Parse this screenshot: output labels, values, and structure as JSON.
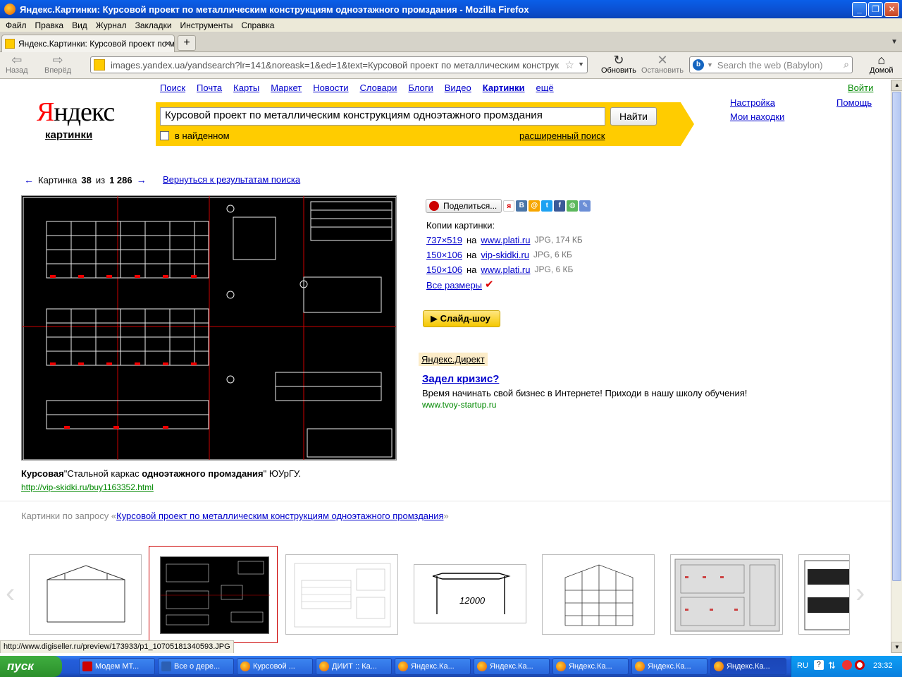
{
  "window": {
    "title": "Яндекс.Картинки: Курсовой проект по металлическим конструкциям одноэтажного промздания - Mozilla Firefox"
  },
  "menu": [
    "Файл",
    "Правка",
    "Вид",
    "Журнал",
    "Закладки",
    "Инструменты",
    "Справка"
  ],
  "tab": {
    "label": "Яндекс.Картинки: Курсовой проект по ме..."
  },
  "nav": {
    "back": "Назад",
    "forward": "Вперёд",
    "url": "images.yandex.ua/yandsearch?lr=141&noreask=1&ed=1&text=Курсовой проект по металлическим конструк",
    "reload": "Обновить",
    "stop": "Остановить",
    "search_placeholder": "Search the web (Babylon)",
    "home": "Домой"
  },
  "yandex": {
    "logo": "Яндекс",
    "logo_sub": "картинки",
    "services": [
      "Поиск",
      "Почта",
      "Карты",
      "Маркет",
      "Новости",
      "Словари",
      "Блоги",
      "Видео",
      "Картинки",
      "ещё"
    ],
    "query": "Курсовой проект по металлическим конструкциям одноэтажного промздания",
    "search_button": "Найти",
    "in_found": "в найденном",
    "advanced": "расширенный поиск",
    "login": "Войти",
    "settings": "Настройка",
    "help": "Помощь",
    "my_finds": "Мои находки"
  },
  "pager": {
    "prefix": "Картинка",
    "current": "38",
    "of": "из",
    "total": "1 286",
    "back_to_results": "Вернуться к результатам поиска"
  },
  "image": {
    "caption_bold1": "Курсовая",
    "caption_mid": "\"Стальной каркас ",
    "caption_bold2": "одноэтажного промздания",
    "caption_end": "\" ЮУрГУ.",
    "url": "http://vip-skidki.ru/buy1163352.html"
  },
  "share": {
    "label": "Поделиться..."
  },
  "copies": {
    "title": "Копии картинки:",
    "on": "на",
    "rows": [
      {
        "dims": "737×519",
        "site": "www.plati.ru",
        "meta": "JPG, 174 КБ"
      },
      {
        "dims": "150×106",
        "site": "vip-skidki.ru",
        "meta": "JPG, 6 КБ"
      },
      {
        "dims": "150×106",
        "site": "www.plati.ru",
        "meta": "JPG, 6 КБ"
      }
    ],
    "all_sizes": "Все размеры"
  },
  "slideshow": "Слайд-шоу",
  "ad": {
    "direct": "Яндекс.Директ",
    "title": "Задел кризис?",
    "text": "Время начинать свой бизнес в Интернете! Приходи в нашу школу обучения!",
    "url": "www.tvoy-startup.ru"
  },
  "related": {
    "prefix": "Картинки по запросу «",
    "query": "Курсовой проект по металлическим конструкциям одноэтажного промздания",
    "suffix": "»"
  },
  "thumb_text": {
    "span": "12000"
  },
  "status_bar": "http://www.digiseller.ru/preview/173933/p1_10705181340593.JPG",
  "taskbar": {
    "start": "пуск",
    "tasks": [
      "Модем МТ...",
      "Все о дере...",
      "Курсовой ...",
      "ДИИТ :: Ка...",
      "Яндекс.Ка...",
      "Яндекс.Ка...",
      "Яндекс.Ка...",
      "Яндекс.Ка...",
      "Яндекс.Ка..."
    ],
    "lang": "RU",
    "time": "23:32"
  }
}
